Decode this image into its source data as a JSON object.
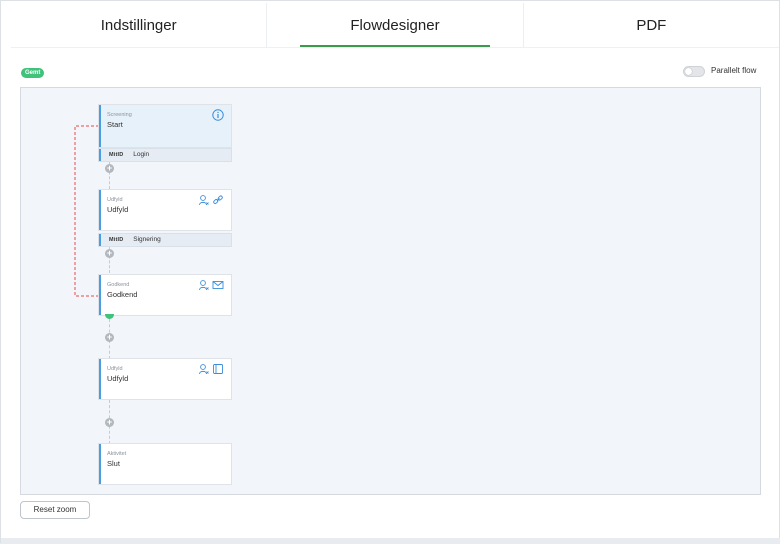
{
  "tabs": [
    {
      "label": "Indstillinger",
      "active": false
    },
    {
      "label": "Flowdesigner",
      "active": true
    },
    {
      "label": "PDF",
      "active": false
    }
  ],
  "status_badge": "Gemt",
  "parallel_toggle": {
    "label": "Parallelt flow",
    "on": false
  },
  "flow": {
    "nodes": [
      {
        "type": "Screening",
        "name": "Start"
      },
      {
        "type": "Udfyld",
        "name": "Udfyld"
      },
      {
        "type": "Godkend",
        "name": "Godkend"
      },
      {
        "type": "Udfyld",
        "name": "Udfyld"
      },
      {
        "type": "Aktivitet",
        "name": "Slut"
      }
    ],
    "auth_steps": [
      {
        "provider": "MitID",
        "label": "Login"
      },
      {
        "provider": "MitID",
        "label": "Signering"
      }
    ],
    "plus_symbol": "+"
  },
  "reset_zoom_label": "Reset zoom",
  "colors": {
    "accent": "#3c9a4c",
    "node_border": "#4a9de0",
    "badge": "#3fc27a",
    "loop_line": "#e8494b"
  },
  "icons": {
    "info": "info-icon",
    "user": "user-icon",
    "link": "link-icon",
    "mail": "mail-icon",
    "book": "book-icon"
  }
}
